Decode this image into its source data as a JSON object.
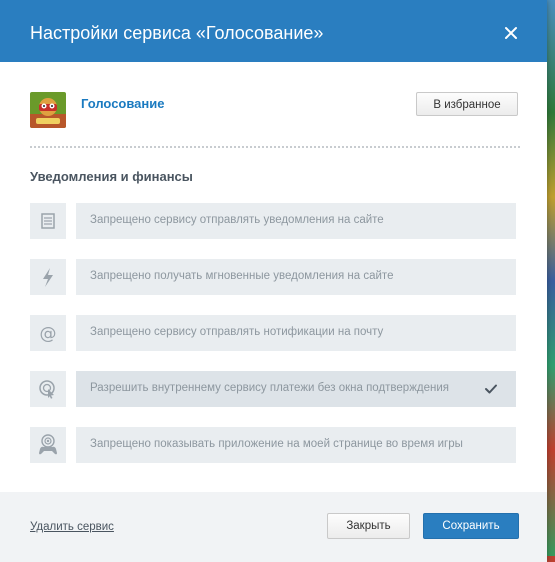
{
  "dialog": {
    "title": "Настройки сервиса «Голосование»"
  },
  "app": {
    "name": "Голосование",
    "favorite_label": "В избранное"
  },
  "section": {
    "title": "Уведомления и финансы"
  },
  "permissions": [
    {
      "icon": "page-icon",
      "label": "Запрещено сервису отправлять уведомления на сайте",
      "enabled": false
    },
    {
      "icon": "lightning-icon",
      "label": "Запрещено получать мгновенные уведомления на сайте",
      "enabled": false
    },
    {
      "icon": "at-sign-icon",
      "label": "Запрещено сервису отправлять нотификации на почту",
      "enabled": false
    },
    {
      "icon": "cursor-click-icon",
      "label": "Разрешить внутреннему сервису платежи без окна подтверждения",
      "enabled": true
    },
    {
      "icon": "gamepad-broadcast-icon",
      "label": "Запрещено показывать приложение на моей странице во время игры",
      "enabled": false
    }
  ],
  "footer": {
    "delete_label": "Удалить сервис",
    "close_label": "Закрыть",
    "save_label": "Сохранить"
  },
  "colors": {
    "header": "#2a7ec0",
    "link": "#1a7ac0",
    "primary_button": "#2a7ec0",
    "row_bg": "#e9edf0"
  }
}
